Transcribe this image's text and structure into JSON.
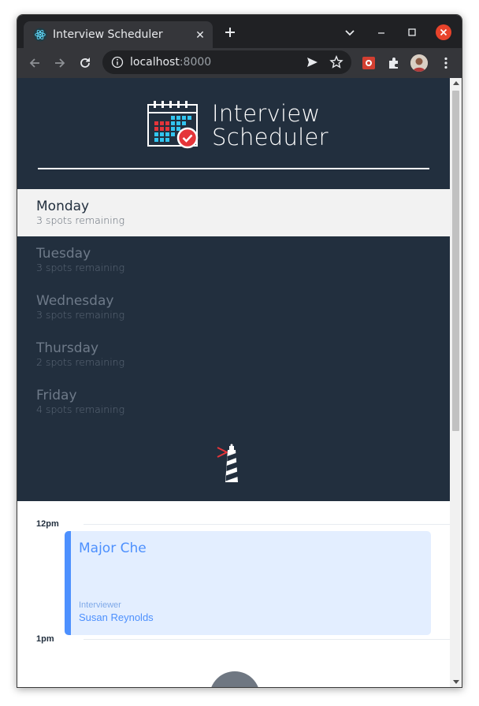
{
  "browser": {
    "tab_title": "Interview Scheduler",
    "tab_close": "✕",
    "url_host": "localhost",
    "url_port": ":8000"
  },
  "app": {
    "brand_line1": "Interview",
    "brand_line2": "Scheduler"
  },
  "days": [
    {
      "name": "Monday",
      "spots": "3 spots remaining",
      "selected": true
    },
    {
      "name": "Tuesday",
      "spots": "3 spots remaining",
      "selected": false
    },
    {
      "name": "Wednesday",
      "spots": "3 spots remaining",
      "selected": false
    },
    {
      "name": "Thursday",
      "spots": "2 spots remaining",
      "selected": false
    },
    {
      "name": "Friday",
      "spots": "4 spots remaining",
      "selected": false
    }
  ],
  "schedule": {
    "times": [
      "12pm",
      "1pm"
    ],
    "appointment": {
      "student": "Major Che",
      "interviewer_label": "Interviewer",
      "interviewer_name": "Susan Reynolds"
    }
  },
  "colors": {
    "sidebar_bg": "#222f3e",
    "accent_blue": "#4d90fe",
    "card_bg": "#e3eeff",
    "brand_red": "#ef4444"
  }
}
